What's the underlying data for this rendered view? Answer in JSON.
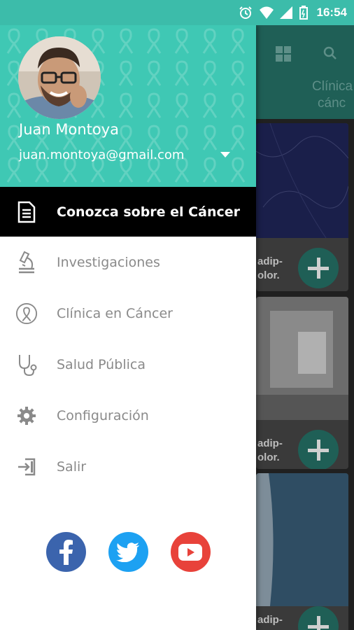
{
  "status_bar": {
    "time": "16:54",
    "icons": [
      "alarm-icon",
      "wifi-icon",
      "signal-icon",
      "battery-icon"
    ]
  },
  "drawer": {
    "user": {
      "name": "Juan Montoya",
      "email": "juan.montoya@gmail.com"
    },
    "menu": [
      {
        "label": "Conozca sobre el Cáncer",
        "icon": "document-icon",
        "active": true
      },
      {
        "label": "Investigaciones",
        "icon": "microscope-icon",
        "active": false
      },
      {
        "label": "Clínica en Cáncer",
        "icon": "ribbon-icon",
        "active": false
      },
      {
        "label": "Salud Pública",
        "icon": "stethoscope-icon",
        "active": false
      },
      {
        "label": "Configuración",
        "icon": "gear-icon",
        "active": false
      },
      {
        "label": "Salir",
        "icon": "exit-icon",
        "active": false
      }
    ],
    "social": [
      {
        "name": "facebook",
        "color": "#3b64ad"
      },
      {
        "name": "twitter",
        "color": "#1da1f2"
      },
      {
        "name": "youtube",
        "color": "#e8423a"
      }
    ]
  },
  "background": {
    "title_line1": "Clínica",
    "title_line2": "cánc",
    "cards": [
      {
        "text_line1": "adip-",
        "text_line2": "olor."
      },
      {
        "text_line1": "adip-",
        "text_line2": "olor."
      },
      {
        "text_line1": "adip-",
        "text_line2": ""
      }
    ]
  },
  "colors": {
    "status_bar": "#3cbcaa",
    "header": "#3fc8b4",
    "active_item": "#000000",
    "fab": "#1f5f56"
  }
}
